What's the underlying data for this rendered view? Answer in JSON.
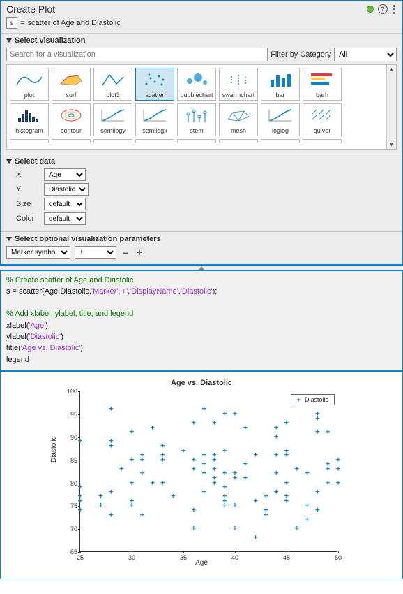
{
  "header": {
    "title": "Create Plot",
    "help": "?",
    "var": "s",
    "equals": "=",
    "subtitle": "scatter of Age and Diastolic"
  },
  "sections": {
    "select_viz": "Select visualization",
    "select_data": "Select data",
    "select_opt": "Select optional visualization parameters"
  },
  "search": {
    "placeholder": "Search for a visualization",
    "filter_label": "Filter by Category",
    "filter_value": "All"
  },
  "viz_row1": [
    "plot",
    "surf",
    "plot3",
    "scatter",
    "bubblechart",
    "swarmchart",
    "bar",
    "barh"
  ],
  "viz_row2": [
    "histogram",
    "contour",
    "semilogy",
    "semilogx",
    "stem",
    "mesh",
    "loglog",
    "quiver"
  ],
  "data_rows": [
    {
      "label": "X",
      "value": "Age"
    },
    {
      "label": "Y",
      "value": "Diastolic"
    },
    {
      "label": "Size",
      "value": "default"
    },
    {
      "label": "Color",
      "value": "default"
    }
  ],
  "opt": {
    "param": "Marker symbol",
    "value": "+",
    "minus": "–",
    "plus": "+"
  },
  "code": {
    "c1": "% Create scatter of Age and Diastolic",
    "l1a": "s = scatter(Age,Diastolic,",
    "s1": "'Marker'",
    "s2": "'+'",
    "s3": "'DisplayName'",
    "s4": "'Diastolic'",
    "l1b": ");",
    "c2": "% Add xlabel, ylabel, title, and legend",
    "l2": "xlabel(",
    "s5": "'Age'",
    "l2b": ")",
    "l3": "ylabel(",
    "s6": "'Diastolic'",
    "l3b": ")",
    "l4": "title(",
    "s7": "'Age vs. Diastolic'",
    "l4b": ")",
    "l5": "legend"
  },
  "chart_data": {
    "type": "scatter",
    "title": "Age vs. Diastolic",
    "xlabel": "Age",
    "ylabel": "Diastolic",
    "xlim": [
      25,
      50
    ],
    "ylim": [
      65,
      100
    ],
    "xticks": [
      25,
      30,
      35,
      40,
      45,
      50
    ],
    "yticks": [
      65,
      70,
      75,
      80,
      85,
      90,
      95,
      100
    ],
    "legend": "Diastolic",
    "series": [
      {
        "name": "Diastolic",
        "marker": "+",
        "color": "#0a84c6",
        "x": [
          38,
          43,
          38,
          40,
          49,
          46,
          33,
          40,
          28,
          31,
          45,
          42,
          25,
          39,
          36,
          48,
          32,
          27,
          37,
          50,
          48,
          39,
          41,
          44,
          28,
          25,
          25,
          36,
          30,
          45,
          40,
          25,
          47,
          44,
          48,
          45,
          38,
          40,
          30,
          28,
          29,
          36,
          45,
          32,
          31,
          48,
          25,
          44,
          37,
          39,
          49,
          44,
          43,
          47,
          50,
          38,
          45,
          36,
          38,
          39,
          45,
          42,
          30,
          48,
          36,
          27,
          45,
          28,
          32,
          37,
          33,
          31,
          39,
          37,
          49,
          34,
          30,
          49,
          48,
          33,
          47,
          40,
          25,
          43,
          39,
          41,
          33,
          38,
          44,
          44,
          28,
          30,
          35,
          39,
          42,
          46,
          37,
          31,
          41,
          50
        ],
        "y": [
          93,
          77,
          83,
          75,
          80,
          70,
          88,
          82,
          78,
          86,
          77,
          68,
          74,
          95,
          85,
          95,
          92,
          75,
          96,
          80,
          74,
          79,
          92,
          90,
          89,
          79,
          77,
          83,
          85,
          87,
          81,
          74,
          82,
          92,
          94,
          93,
          80,
          70,
          80,
          96,
          83,
          93,
          76,
          80,
          73,
          74,
          76,
          82,
          84,
          77,
          83,
          78,
          73,
          72,
          85,
          81,
          86,
          70,
          86,
          82,
          80,
          86,
          76,
          78,
          74,
          77,
          93,
          88,
          80,
          82,
          80,
          82,
          87,
          78,
          84,
          77,
          75,
          91,
          91,
          86,
          75,
          95,
          89,
          74,
          75,
          84,
          85,
          85,
          78,
          86,
          73,
          91,
          87,
          76,
          76,
          83,
          86,
          85,
          81,
          83
        ]
      }
    ]
  }
}
